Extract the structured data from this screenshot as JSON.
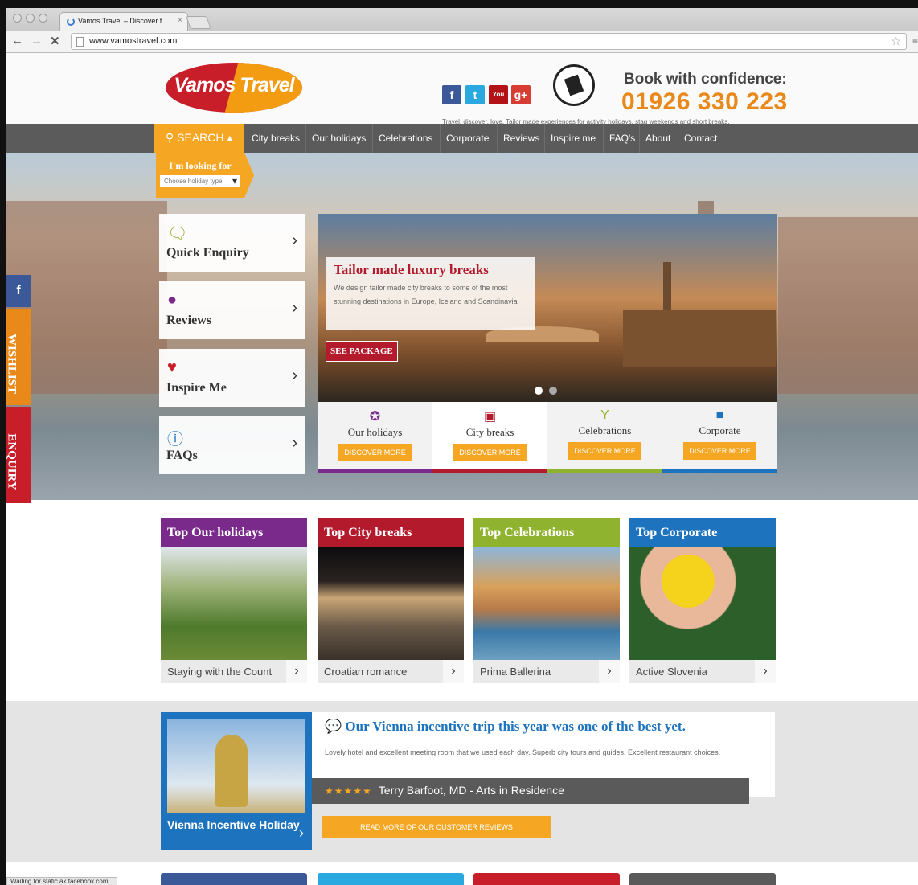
{
  "browser": {
    "tab_title": "Vamos Travel – Discover t",
    "url": "www.vamostravel.com",
    "status": "Waiting for static.ak.facebook.com..."
  },
  "header": {
    "logo_text": "Vamos Travel",
    "book_text": "Book with confidence:",
    "phone": "01926 330 223",
    "tagline": "Travel, discover, love. Tailor made experiences for activity holidays, stag weekends and short breaks.",
    "social": [
      "f",
      "t",
      "You",
      "g+"
    ]
  },
  "nav": {
    "search_label": "SEARCH",
    "items": [
      "City breaks",
      "Our holidays",
      "Celebrations",
      "Corporate",
      "Reviews",
      "Inspire me",
      "FAQ's",
      "About",
      "Contact"
    ],
    "looking_for": "I'm looking for",
    "select_placeholder": "Choose holiday type"
  },
  "side_tabs": {
    "facebook": "f",
    "wishlist": "WISHLIST",
    "enquiry": "ENQUIRY"
  },
  "side_cards": [
    "Quick Enquiry",
    "Reviews",
    "Inspire Me",
    "FAQs"
  ],
  "slide": {
    "title": "Tailor made luxury breaks",
    "desc": "We design tailor made city breaks to some of the most stunning destinations in Europe, Iceland and Scandinavia",
    "button": "SEE PACKAGE"
  },
  "categories": [
    {
      "name": "Our holidays",
      "button": "DISCOVER MORE",
      "color": "#7a2a8a"
    },
    {
      "name": "City breaks",
      "button": "DISCOVER MORE",
      "color": "#b31b2d"
    },
    {
      "name": "Celebrations",
      "button": "DISCOVER MORE",
      "color": "#8fb32e"
    },
    {
      "name": "Corporate",
      "button": "DISCOVER MORE",
      "color": "#1e73be"
    }
  ],
  "top": [
    {
      "heading": "Top Our holidays",
      "caption": "Staying with the Count",
      "color": "#7a2a8a"
    },
    {
      "heading": "Top City breaks",
      "caption": "Croatian romance",
      "color": "#b31b2d"
    },
    {
      "heading": "Top Celebrations",
      "caption": "Prima Ballerina",
      "color": "#8fb32e"
    },
    {
      "heading": "Top Corporate",
      "caption": "Active Slovenia",
      "color": "#1e73be"
    }
  ],
  "testimonial": {
    "card_title": "Vienna Incentive Holiday",
    "quote_title": "Our Vienna incentive trip this year was one of the best yet.",
    "quote_text": "Lovely hotel and excellent meeting room that we used each day. Superb city tours and guides. Excellent restaurant choices.",
    "stars": "★★★★★",
    "author": "Terry Barfoot, MD - Arts in Residence",
    "read_more": "READ MORE OF OUR CUSTOMER REVIEWS"
  }
}
